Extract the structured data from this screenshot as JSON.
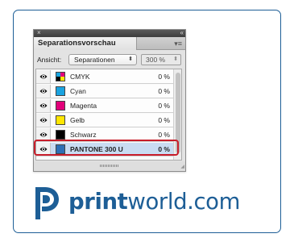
{
  "panel": {
    "title": "Separationsvorschau",
    "close_icon": "×",
    "collapse_icon": "«",
    "menu_icon": "▾≡",
    "view_label": "Ansicht:",
    "view_value": "Separationen",
    "zoom_value": "300 %",
    "separations": [
      {
        "name": "CMYK",
        "percent": "0 %",
        "color": "cmyk",
        "selected": false
      },
      {
        "name": "Cyan",
        "percent": "0 %",
        "color": "#1aa3e0",
        "selected": false
      },
      {
        "name": "Magenta",
        "percent": "0 %",
        "color": "#e2007a",
        "selected": false
      },
      {
        "name": "Gelb",
        "percent": "0 %",
        "color": "#ffe600",
        "selected": false
      },
      {
        "name": "Schwarz",
        "percent": "0 %",
        "color": "#000000",
        "selected": false
      },
      {
        "name": "PANTONE 300 U",
        "percent": "0 %",
        "color": "#2d6fb5",
        "selected": true
      }
    ],
    "highlight_color": "#c81d2a"
  },
  "brand": {
    "name_bold": "print",
    "name_rest": "world.com",
    "color": "#1d5e96"
  }
}
